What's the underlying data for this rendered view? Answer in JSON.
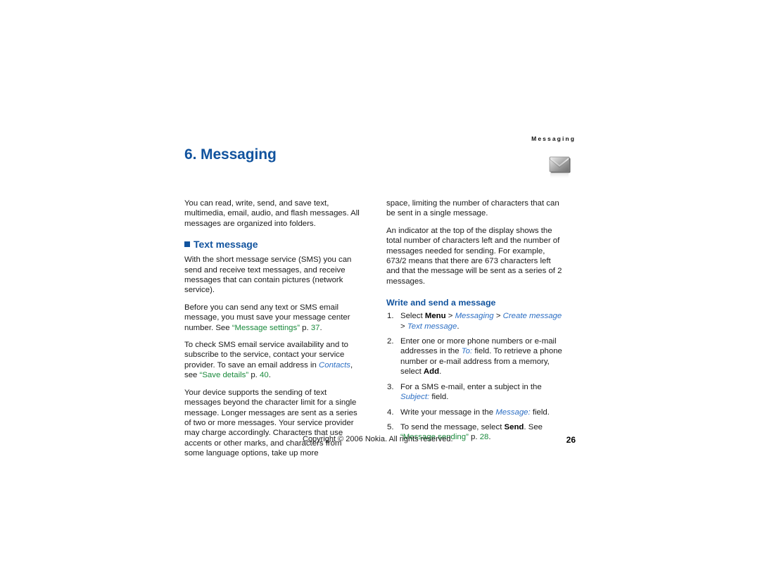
{
  "running_header": "Messaging",
  "chapter": {
    "title": "6. Messaging",
    "icon": "envelope-icon"
  },
  "colors": {
    "heading_blue": "#11539e",
    "link_green": "#1a8a3c",
    "ui_italic_blue": "#2d6fc4",
    "body_text": "#1a1a1a"
  },
  "left_column": {
    "intro_paragraph": "You can read, write, send, and save text, multimedia, email, audio, and flash messages. All messages are organized into folders.",
    "section_heading": "Text message",
    "para_sms": "With the short message service (SMS) you can send and receive text messages, and receive messages that can contain pictures (network service).",
    "para_center_number": {
      "before": "Before you can send any text or SMS email message, you must save your message center number. See ",
      "xref": "“Message settings”",
      "page_label": " p. ",
      "page_num": "37",
      "after": "."
    },
    "para_subscribe": {
      "before": "To check SMS email service availability and to subscribe to the service, contact your service provider. To save an email address in ",
      "ui_item": "Contacts",
      "mid": ", see ",
      "xref": "“Save details”",
      "page_label": " p. ",
      "page_num": "40",
      "after": "."
    },
    "para_long_messages": "Your device supports the sending of text messages beyond the character limit for a single message. Longer messages are sent as a series of two or more messages. Your service provider may charge accordingly. Characters that use accents or other marks, and characters from some language options, take up more"
  },
  "right_column": {
    "para_space_cont": "space, limiting the number of characters that can be sent in a single message.",
    "para_indicator": "An indicator at the top of the display shows the total number of characters left and the number of messages needed for sending. For example, 673/2 means that there are 673 characters left and that the message will be sent as a series of 2 messages.",
    "subsection_heading": "Write and send a message",
    "steps": [
      {
        "num": "1.",
        "parts": [
          {
            "t": "Select ",
            "s": "plain"
          },
          {
            "t": "Menu",
            "s": "bold"
          },
          {
            "t": " > ",
            "s": "sep"
          },
          {
            "t": "Messaging",
            "s": "ital"
          },
          {
            "t": " > ",
            "s": "sep"
          },
          {
            "t": "Create message",
            "s": "ital"
          },
          {
            "t": " > ",
            "s": "sep"
          },
          {
            "t": "Text message",
            "s": "ital"
          },
          {
            "t": ".",
            "s": "plain"
          }
        ]
      },
      {
        "num": "2.",
        "parts": [
          {
            "t": "Enter one or more phone numbers or e-mail addresses in the ",
            "s": "plain"
          },
          {
            "t": "To:",
            "s": "ital"
          },
          {
            "t": " field. To retrieve a phone number or e-mail address from a memory, select ",
            "s": "plain"
          },
          {
            "t": "Add",
            "s": "bold"
          },
          {
            "t": ".",
            "s": "plain"
          }
        ]
      },
      {
        "num": "3.",
        "parts": [
          {
            "t": "For a SMS e-mail, enter a subject in the ",
            "s": "plain"
          },
          {
            "t": "Subject:",
            "s": "ital"
          },
          {
            "t": " field.",
            "s": "plain"
          }
        ]
      },
      {
        "num": "4.",
        "parts": [
          {
            "t": "Write your message in the ",
            "s": "plain"
          },
          {
            "t": "Message:",
            "s": "ital"
          },
          {
            "t": " field.",
            "s": "plain"
          }
        ]
      },
      {
        "num": "5.",
        "parts": [
          {
            "t": "To send the message, select ",
            "s": "plain"
          },
          {
            "t": "Send",
            "s": "bold"
          },
          {
            "t": ". See ",
            "s": "plain"
          },
          {
            "t": "“Message sending”",
            "s": "xref"
          },
          {
            "t": " p. ",
            "s": "plain"
          },
          {
            "t": "28",
            "s": "xref"
          },
          {
            "t": ".",
            "s": "plain"
          }
        ]
      }
    ]
  },
  "footer": {
    "copyright": "Copyright © 2006 Nokia. All rights reserved.",
    "page_number": "26"
  }
}
